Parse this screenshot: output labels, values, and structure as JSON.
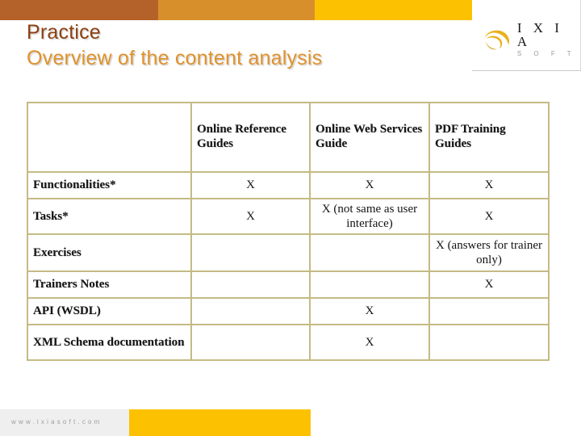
{
  "header": {
    "bands": [
      {
        "name": "brown",
        "color": "#b5622a"
      },
      {
        "name": "orange",
        "color": "#d78f2c"
      },
      {
        "name": "yellow",
        "color": "#fcc202"
      }
    ],
    "title": "Practice",
    "subtitle": "Overview of the content analysis",
    "title_color": "#8c3f11",
    "subtitle_color": "#e0922d"
  },
  "logo": {
    "wordmark": "I X I A",
    "tagline": "S O F T",
    "mark_color": "#e8b21e"
  },
  "table": {
    "border_color": "#c4bb85",
    "corner_label": "",
    "columns": [
      "Online Reference Guides",
      "Online Web Services Guide",
      "PDF Training Guides"
    ],
    "rows": [
      {
        "label": "Functionalities*",
        "cells": [
          "X",
          "X",
          "X"
        ]
      },
      {
        "label": "Tasks*",
        "cells": [
          "X",
          "X (not same as user interface)",
          "X"
        ]
      },
      {
        "label": "Exercises",
        "cells": [
          "",
          "",
          "X (answers for trainer only)"
        ]
      },
      {
        "label": "Trainers Notes",
        "cells": [
          "",
          "",
          "X"
        ]
      },
      {
        "label": "API (WSDL)",
        "cells": [
          "",
          "X",
          ""
        ]
      },
      {
        "label": "XML Schema documentation",
        "cells": [
          "",
          "X",
          ""
        ]
      }
    ]
  },
  "footer": {
    "url": "www.ixiasoft.com",
    "grey_color": "#efefef",
    "yellow_color": "#fcc202"
  }
}
